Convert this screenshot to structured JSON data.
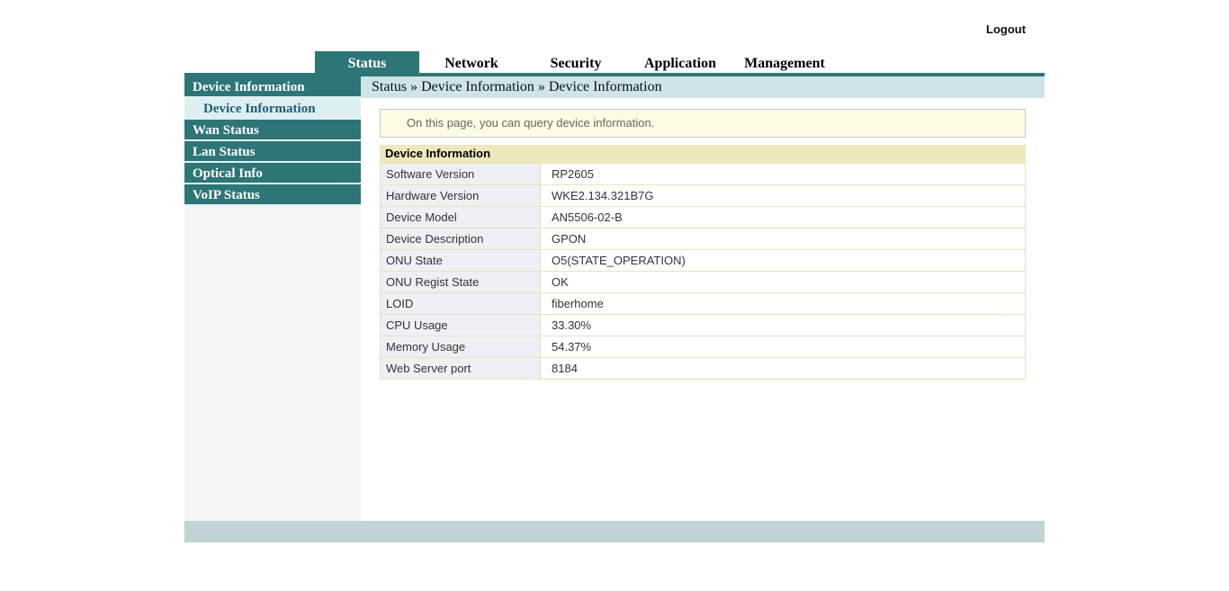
{
  "header": {
    "logout": "Logout"
  },
  "nav": {
    "tabs": [
      {
        "label": "Status",
        "active": true
      },
      {
        "label": "Network",
        "active": false
      },
      {
        "label": "Security",
        "active": false
      },
      {
        "label": "Application",
        "active": false
      },
      {
        "label": "Management",
        "active": false
      }
    ]
  },
  "sidebar": {
    "items": [
      {
        "label": "Device Information",
        "selected": false
      },
      {
        "label": "Device Information",
        "selected": true
      },
      {
        "label": "Wan Status",
        "selected": false
      },
      {
        "label": "Lan Status",
        "selected": false
      },
      {
        "label": "Optical Info",
        "selected": false
      },
      {
        "label": "VoIP Status",
        "selected": false
      }
    ]
  },
  "breadcrumb": {
    "text": "Status » Device Information » Device Information"
  },
  "main": {
    "info_message": "On this page, you can query device information.",
    "table": {
      "title": "Device Information",
      "rows": [
        {
          "label": "Software Version",
          "value": "RP2605"
        },
        {
          "label": "Hardware Version",
          "value": "WKE2.134.321B7G"
        },
        {
          "label": "Device Model",
          "value": "AN5506-02-B"
        },
        {
          "label": "Device Description",
          "value": "GPON"
        },
        {
          "label": "ONU State",
          "value": "O5(STATE_OPERATION)"
        },
        {
          "label": "ONU Regist State",
          "value": "OK"
        },
        {
          "label": "LOID",
          "value": "fiberhome"
        },
        {
          "label": "CPU Usage",
          "value": "33.30%"
        },
        {
          "label": "Memory Usage",
          "value": "54.37%"
        },
        {
          "label": "Web Server port",
          "value": "8184"
        }
      ]
    }
  },
  "colors": {
    "teal": "#2D7577",
    "breadcrumb_bg": "#CEE4E8",
    "selected_item_bg": "#DEEFF2",
    "selected_item_text": "#1F5B73",
    "info_box_bg": "#FDFCE2",
    "table_header_bg": "#EFE8BD",
    "table_border": "#E9E3B8",
    "label_cell_bg": "#EFEFF6",
    "footer_bar_bg": "#C0D4D5"
  }
}
